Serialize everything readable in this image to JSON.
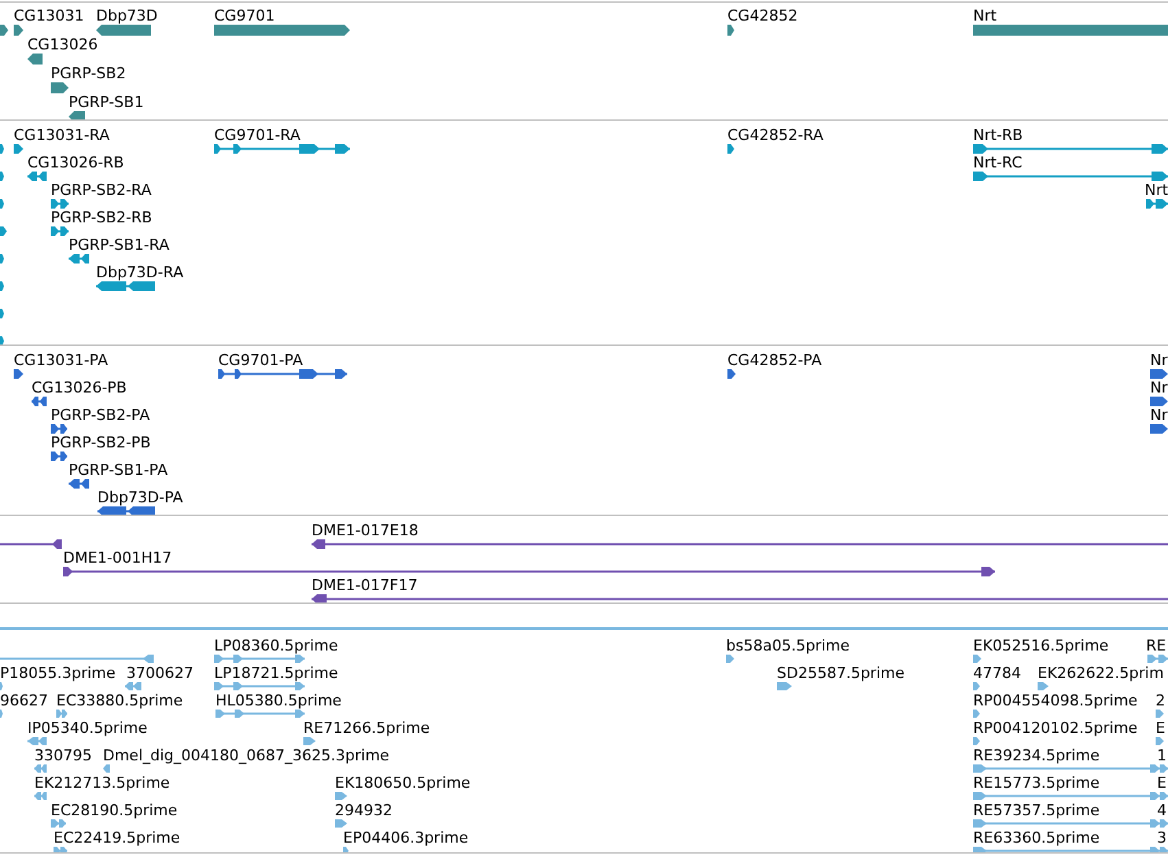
{
  "tracks": [
    {
      "kind": "gene",
      "color": "#3f8f93",
      "features": [
        {
          "reverse": false
        },
        {
          "label": "CG13031",
          "reverse": false
        },
        {
          "label": "Dbp73D",
          "reverse": true
        },
        {
          "label": "CG9701",
          "reverse": false
        },
        {
          "label": "CG42852",
          "reverse": false
        },
        {
          "label": "Nrt",
          "reverse": false
        },
        {
          "label": "CG13026",
          "reverse": true
        },
        {
          "label": "PGRP-SB2",
          "reverse": false
        },
        {
          "label": "PGRP-SB1",
          "reverse": true
        }
      ]
    },
    {
      "kind": "transcript",
      "color": "#149fc4",
      "features": [
        {
          "reverse": false
        },
        {
          "reverse": false
        },
        {
          "reverse": false
        },
        {
          "reverse": false
        },
        {
          "reverse": false
        },
        {
          "reverse": false
        },
        {
          "reverse": false
        },
        {
          "reverse": false
        },
        {
          "label": "CG13031-RA",
          "reverse": false
        },
        {
          "label": "CG9701-RA",
          "reverse": false
        },
        {
          "label": "CG42852-RA",
          "reverse": false
        },
        {
          "label": "Nrt-RB",
          "reverse": false
        },
        {
          "label": "CG13026-RB",
          "reverse": true
        },
        {
          "label": "Nrt-RC",
          "reverse": false
        },
        {
          "label": "Nrt",
          "reverse": false
        },
        {
          "label": "PGRP-SB2-RA",
          "reverse": false
        },
        {
          "label": "PGRP-SB2-RB",
          "reverse": false
        },
        {
          "label": "PGRP-SB1-RA",
          "reverse": true
        },
        {
          "label": "Dbp73D-RA",
          "reverse": true
        }
      ]
    },
    {
      "kind": "protein",
      "color": "#2f6fd0",
      "features": [
        {
          "label": "CG13031-PA",
          "reverse": false
        },
        {
          "label": "CG9701-PA",
          "reverse": false
        },
        {
          "label": "CG42852-PA",
          "reverse": false
        },
        {
          "label": "Nr",
          "reverse": false
        },
        {
          "label": "CG13026-PB",
          "reverse": true
        },
        {
          "label": "Nr",
          "reverse": false
        },
        {
          "label": "PGRP-SB2-PA",
          "reverse": false
        },
        {
          "label": "Nr",
          "reverse": false
        },
        {
          "label": "PGRP-SB2-PB",
          "reverse": false
        },
        {
          "label": "PGRP-SB1-PA",
          "reverse": true
        },
        {
          "label": "Dbp73D-PA",
          "reverse": true
        }
      ]
    },
    {
      "kind": "clone",
      "color": "#7050b0",
      "features": [
        {
          "reverse": true
        },
        {
          "label": "DME1-017E18",
          "reverse": true
        },
        {
          "label": "DME1-001H17",
          "reverse": false
        },
        {
          "label": "DME1-017F17",
          "reverse": true
        }
      ]
    },
    {
      "kind": "est",
      "color": "#7ab8e0",
      "features": [
        {
          "reverse": true
        },
        {
          "label": "LP08360.5prime",
          "reverse": false
        },
        {
          "label": "bs58a05.5prime",
          "reverse": false
        },
        {
          "label": "EK052516.5prime",
          "reverse": false
        },
        {
          "label": "RE",
          "reverse": false
        },
        {
          "label": "P18055.3prime",
          "reverse": false
        },
        {
          "label": "3700627",
          "reverse": true
        },
        {
          "label": "LP18721.5prime",
          "reverse": false
        },
        {
          "label": "SD25587.5prime",
          "reverse": false
        },
        {
          "label": "47784",
          "reverse": false
        },
        {
          "label": "EK262622.5prim",
          "reverse": false
        },
        {
          "label": "96627",
          "reverse": false
        },
        {
          "label": "EC33880.5prime",
          "reverse": false
        },
        {
          "label": "HL05380.5prime",
          "reverse": false
        },
        {
          "label": "RP004554098.5prime",
          "reverse": false
        },
        {
          "label": "2",
          "reverse": false
        },
        {
          "label": "IP05340.5prime",
          "reverse": true
        },
        {
          "label": "RE71266.5prime",
          "reverse": false
        },
        {
          "label": "RP004120102.5prime",
          "reverse": false
        },
        {
          "label": "E",
          "reverse": false
        },
        {
          "label": "330795",
          "reverse": true
        },
        {
          "label": "Dmel_dig_004180_0687_3625.3prime",
          "reverse": true
        },
        {
          "label": "RE39234.5prime",
          "reverse": false
        },
        {
          "label": "1"
        },
        {
          "label": "EK212713.5prime",
          "reverse": true
        },
        {
          "label": "EK180650.5prime",
          "reverse": false
        },
        {
          "label": "RE15773.5prime",
          "reverse": false
        },
        {
          "label": "E"
        },
        {
          "label": "EC28190.5prime",
          "reverse": false
        },
        {
          "label": "294932",
          "reverse": false
        },
        {
          "label": "RE57357.5prime",
          "reverse": false
        },
        {
          "label": "4"
        },
        {
          "label": "EC22419.5prime",
          "reverse": false
        },
        {
          "label": "EP04406.3prime",
          "reverse": false
        },
        {
          "label": "RE63360.5prime",
          "reverse": false
        },
        {
          "label": "3"
        }
      ]
    }
  ]
}
